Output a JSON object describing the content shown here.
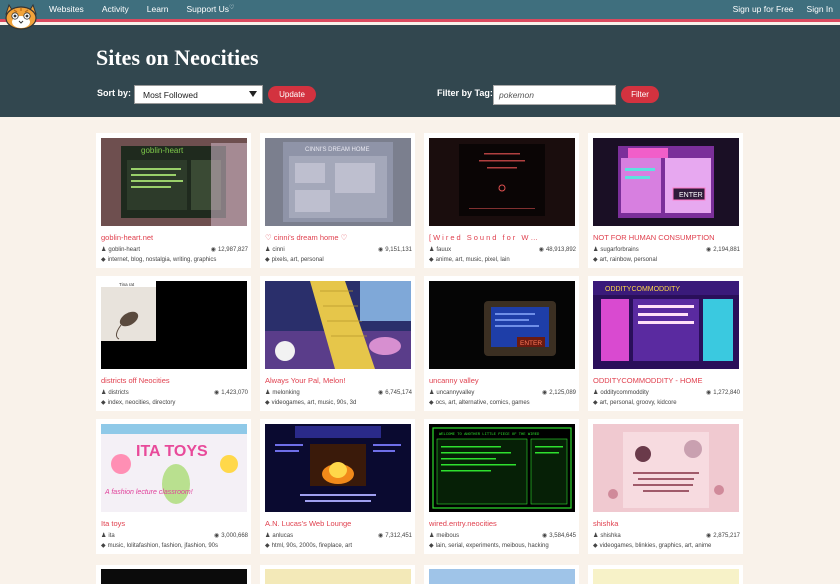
{
  "nav": {
    "links": [
      "Websites",
      "Activity",
      "Learn",
      "Support Us"
    ],
    "right": [
      "Sign up for Free",
      "Sign In"
    ]
  },
  "header": {
    "title": "Sites on Neocities",
    "sort_label": "Sort by:",
    "sort_value": "Most Followed",
    "update_label": "Update",
    "filter_label": "Filter by Tag:",
    "filter_value": "pokemon",
    "filter_button": "Filter"
  },
  "sites": [
    {
      "title": "goblin-heart.net",
      "owner": "goblin-heart",
      "views": "12,987,827",
      "tags": "internet, blog, nostalgia, writing, graphics"
    },
    {
      "title": "♡ cinni's dream home ♡",
      "owner": "cinni",
      "views": "9,151,131",
      "tags": "pixels, art, personal"
    },
    {
      "title": "[Wired Sound for W…",
      "owner": "fauux",
      "views": "48,913,892",
      "tags": "anime, art, music, pixel, lain"
    },
    {
      "title": "NOT FOR HUMAN CONSUMPTION",
      "owner": "sugarforbrains",
      "views": "2,194,881",
      "tags": "art, rainbow, personal"
    },
    {
      "title": "districts off Neocities",
      "owner": "districts",
      "views": "1,423,070",
      "tags": "index, neocities, directory"
    },
    {
      "title": "Always Your Pal, Melon!",
      "owner": "melonking",
      "views": "6,745,174",
      "tags": "videogames, art, music, 90s, 3d"
    },
    {
      "title": "uncanny valley",
      "owner": "uncannyvalley",
      "views": "2,125,089",
      "tags": "ocs, art, alternative, comics, games"
    },
    {
      "title": "ODDITYCOMMODDITY - HOME",
      "owner": "odditycommoddity",
      "views": "1,272,840",
      "tags": "art, personal, groovy, kidcore"
    },
    {
      "title": "Ita toys",
      "owner": "ita",
      "views": "3,000,668",
      "tags": "music, lolitafashion, fashion, jfashion, 90s"
    },
    {
      "title": "A.N. Lucas's Web Lounge",
      "owner": "anlucas",
      "views": "7,312,451",
      "tags": "html, 90s, 2000s, fireplace, art"
    },
    {
      "title": "wired.entry.neocities",
      "owner": "meibous",
      "views": "3,584,645",
      "tags": "lain, serial, experiments, meibous, hacking"
    },
    {
      "title": "shishka",
      "owner": "shishka",
      "views": "2,875,217",
      "tags": "videogames, blinkies, graphics, art, anime"
    }
  ],
  "thumb_labels": {
    "goblin": "goblin-heart",
    "cinni": "CINNI'S DREAM HOME",
    "districts": "Tina rat",
    "uncanny": "ENTER",
    "oddity": "ODDITYCOMMODDITY",
    "notforhuman": "ENTER",
    "ita": "ITA TOYS",
    "ita_sub": "A fashion lecture classroom!",
    "wired": "WELCOME TO ANOTHER LITTLE PIECE OF THE WIRED"
  },
  "colors": {
    "nav": "#3f6f7e",
    "header": "#32474f",
    "accent": "#d3323f",
    "link": "#e0414f",
    "background": "#f9f2ea"
  }
}
